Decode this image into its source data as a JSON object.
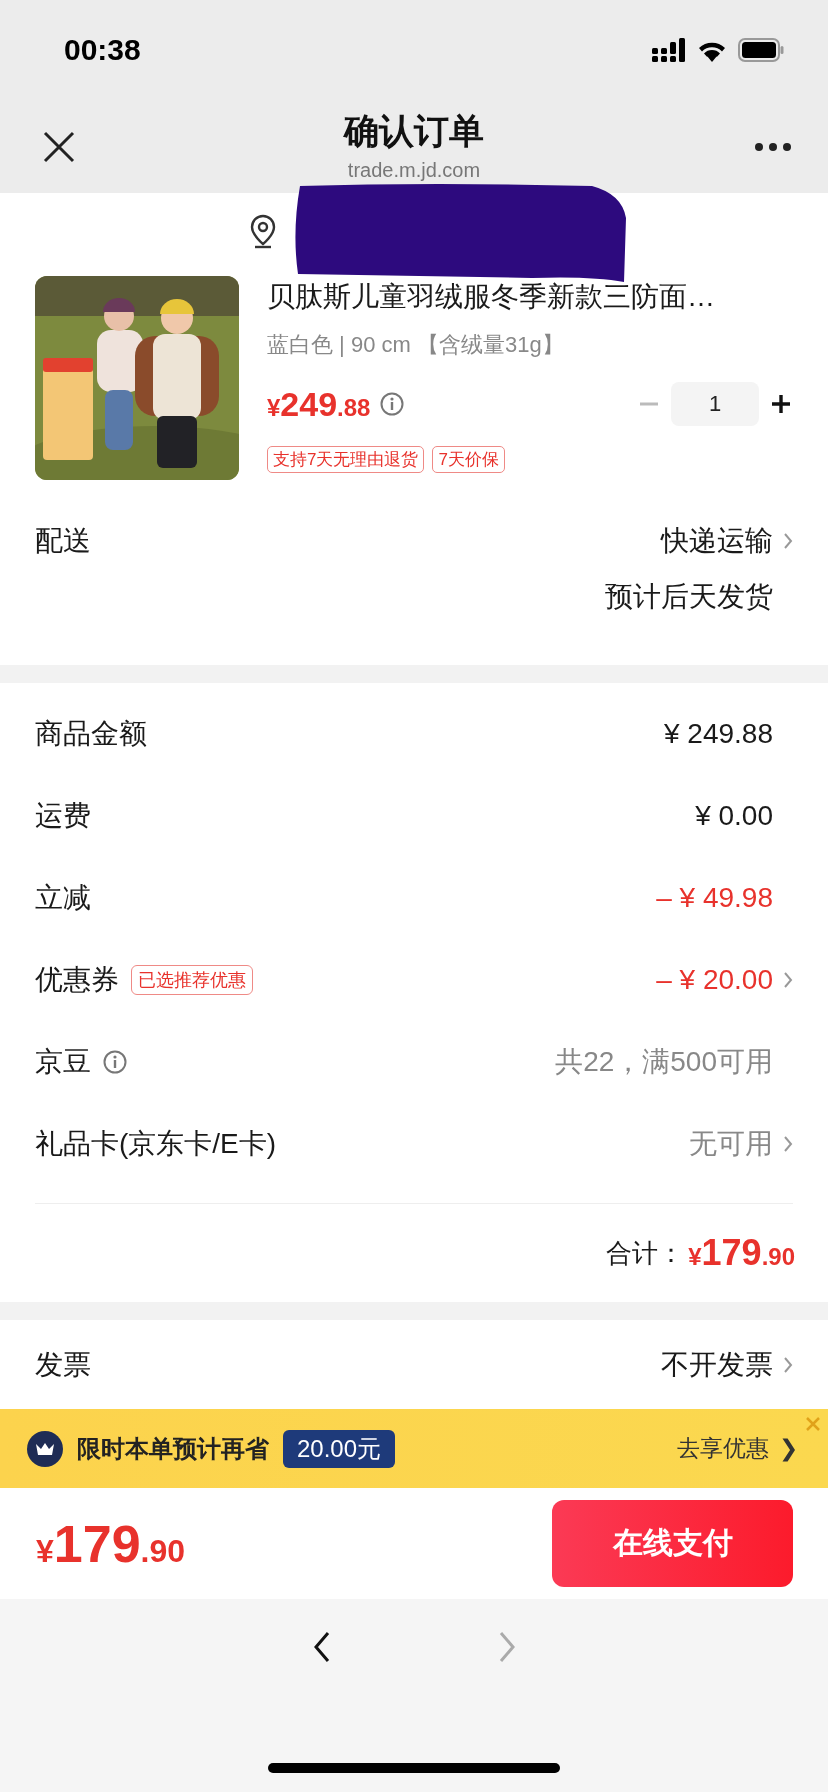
{
  "status_bar": {
    "time": "00:38"
  },
  "nav": {
    "title": "确认订单",
    "subtitle": "trade.m.jd.com"
  },
  "product": {
    "title": "贝肽斯儿童羽绒服冬季新款三防面…",
    "spec": "蓝白色 | 90 cm 【含绒量31g】",
    "price": {
      "symbol": "¥",
      "integer": "249",
      "decimal": ".88"
    },
    "quantity": "1",
    "tags": [
      "支持7天无理由退货",
      "7天价保"
    ]
  },
  "delivery": {
    "label": "配送",
    "method": "快递运输",
    "eta": "预计后天发货"
  },
  "summary": [
    {
      "label": "商品金额",
      "kind": "plain",
      "value": "¥ 249.88",
      "arrow": false
    },
    {
      "label": "运费",
      "kind": "plain",
      "value": "¥ 0.00",
      "arrow": false
    },
    {
      "label": "立减",
      "kind": "discount",
      "value": "– ¥ 49.98",
      "arrow": false
    },
    {
      "label": "优惠券",
      "kind": "discount",
      "badge": "已选推荐优惠",
      "value": "– ¥ 20.00",
      "arrow": true
    },
    {
      "label": "京豆",
      "kind": "muted",
      "info": true,
      "value": "共22，满500可用",
      "arrow": false
    },
    {
      "label": "礼品卡(京东卡/E卡)",
      "kind": "muted",
      "value": "无可用",
      "arrow": true
    }
  ],
  "total": {
    "label": "合计：",
    "symbol": "¥",
    "integer": "179",
    "decimal": ".90"
  },
  "invoice": {
    "label": "发票",
    "value": "不开发票"
  },
  "promo": {
    "text": "限时本单预计再省",
    "amount": "20.00元",
    "action": "去享优惠",
    "arrow": "❯"
  },
  "footer": {
    "price": {
      "symbol": "¥",
      "integer": "179",
      "decimal": ".90"
    },
    "pay_button": "在线支付"
  },
  "browser_nav": [
    {
      "kind": "back",
      "disabled": false
    },
    {
      "kind": "forward",
      "disabled": true
    }
  ]
}
